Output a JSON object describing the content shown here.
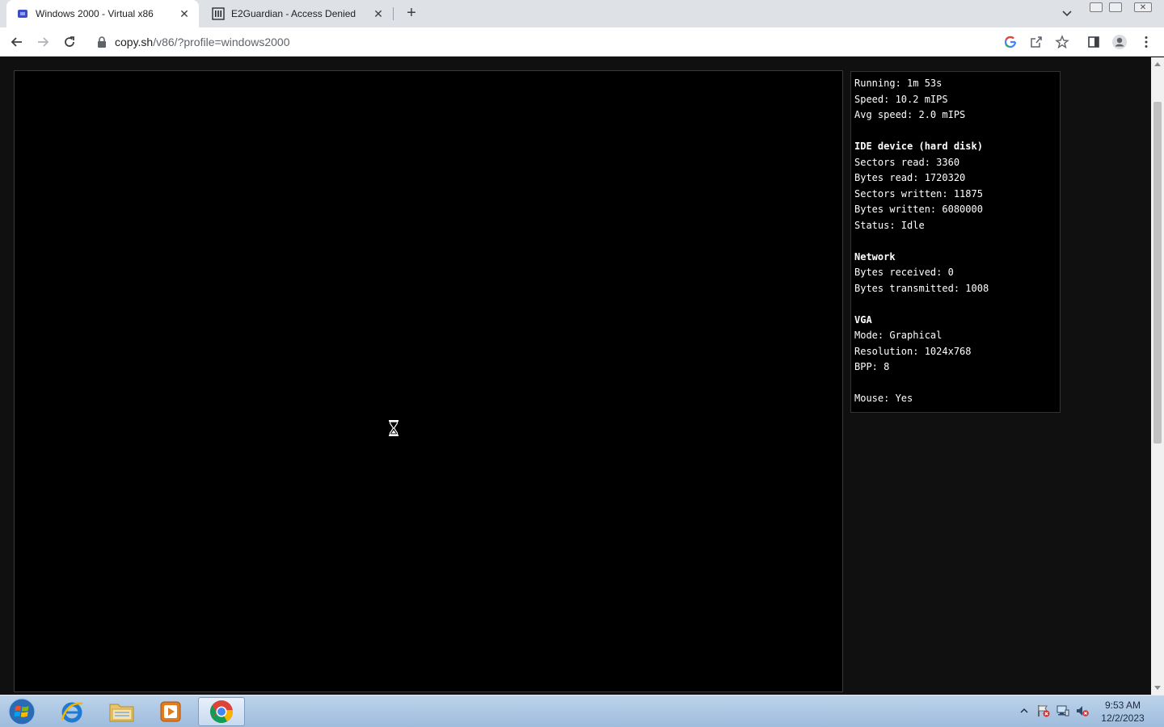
{
  "browser": {
    "tabs": [
      {
        "title": "Windows 2000 - Virtual x86",
        "favicon": "v86-icon",
        "active": true
      },
      {
        "title": "E2Guardian - Access Denied",
        "favicon": "building-icon",
        "active": false
      }
    ],
    "url_host": "copy.sh",
    "url_path": "/v86/?profile=windows2000"
  },
  "stats": {
    "running": "Running: 1m 53s",
    "speed": "Speed: 10.2 mIPS",
    "avg_speed": "Avg speed: 2.0 mIPS",
    "ide_heading": "IDE device (hard disk)",
    "sectors_read": "Sectors read: 3360",
    "bytes_read": "Bytes read: 1720320",
    "sectors_written": "Sectors written: 11875",
    "bytes_written": "Bytes written: 6080000",
    "status": "Status: Idle",
    "network_heading": "Network",
    "bytes_received": "Bytes received: 0",
    "bytes_transmitted": "Bytes transmitted: 1008",
    "vga_heading": "VGA",
    "mode": "Mode: Graphical",
    "resolution": "Resolution: 1024x768",
    "bpp": "BPP: 8",
    "mouse": "Mouse: Yes"
  },
  "taskbar": {
    "apps": [
      "internet-explorer-icon",
      "file-explorer-icon",
      "media-player-icon",
      "chrome-icon"
    ],
    "time": "9:53 AM",
    "date": "12/2/2023"
  },
  "colors": {
    "page_background": "#101010",
    "emulator_screen": "#000000",
    "taskbar": "#b4cce8"
  }
}
